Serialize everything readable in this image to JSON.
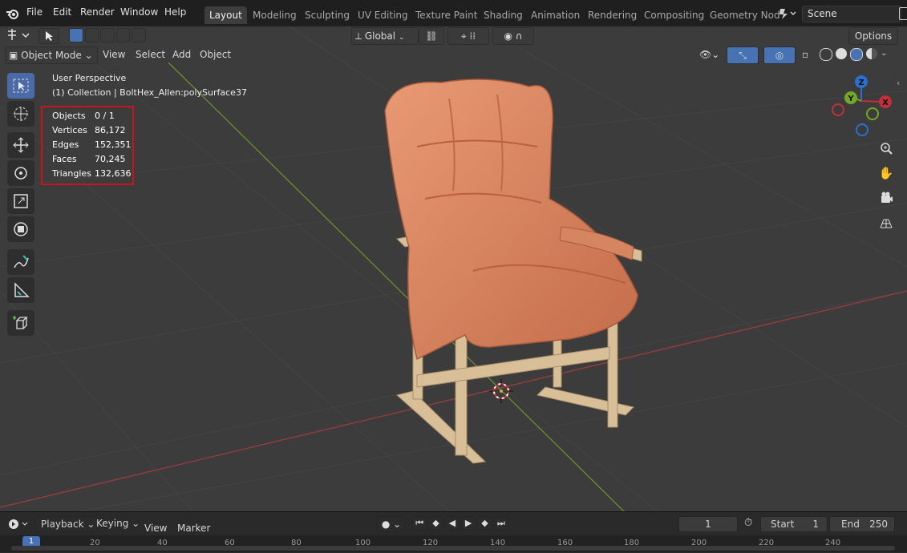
{
  "menu": {
    "items": [
      "File",
      "Edit",
      "Render",
      "Window",
      "Help"
    ]
  },
  "workspaces": [
    "Layout",
    "Modeling",
    "Sculpting",
    "UV Editing",
    "Texture Paint",
    "Shading",
    "Animation",
    "Rendering",
    "Compositing",
    "Geometry Nod"
  ],
  "scene": {
    "name": "Scene"
  },
  "header": {
    "transform_orientation": "Global",
    "options_label": "Options",
    "mode": "Object Mode",
    "view": "View",
    "select": "Select",
    "add": "Add",
    "object": "Object"
  },
  "overlay": {
    "perspective": "User Perspective",
    "collection": "(1) Collection | BoltHex_Allen:polySurface37"
  },
  "stats": [
    {
      "label": "Objects",
      "value": "0 / 1"
    },
    {
      "label": "Vertices",
      "value": "86,172"
    },
    {
      "label": "Edges",
      "value": "152,351"
    },
    {
      "label": "Faces",
      "value": "70,245"
    },
    {
      "label": "Triangles",
      "value": "132,636"
    }
  ],
  "gizmo": {
    "x": "X",
    "y": "Y",
    "z": "Z"
  },
  "colors": {
    "highlight_box": "#c8141c",
    "accent_blue": "#4772b3",
    "x_axis": "#c0313b",
    "y_axis": "#73a824",
    "z_axis": "#2a70d0"
  },
  "timeline": {
    "playback": "Playback",
    "keying": "Keying",
    "view": "View",
    "marker": "Marker",
    "current_frame": "1",
    "start_label": "Start",
    "start_value": "1",
    "end_label": "End",
    "end_value": "250",
    "ruler": [
      "1",
      "20",
      "40",
      "60",
      "80",
      "100",
      "120",
      "140",
      "160",
      "180",
      "200",
      "220",
      "240"
    ]
  }
}
